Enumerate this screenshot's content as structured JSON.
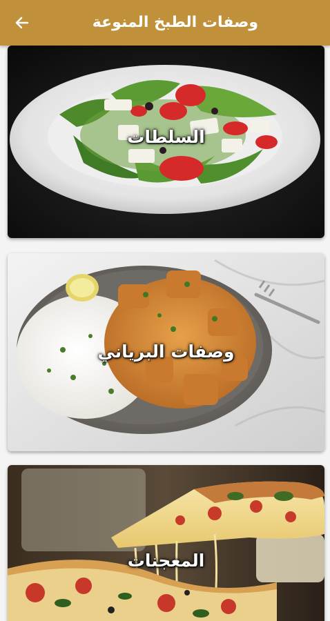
{
  "app": {
    "title": "وصفات الطبخ المنوعة",
    "back_icon": "arrow-left-icon"
  },
  "colors": {
    "appbar": "#c0913a",
    "title_text": "#ffffff"
  },
  "categories": [
    {
      "label": "السلطات",
      "image": "salad-plate"
    },
    {
      "label": "وصفات البرياني",
      "image": "biryani-plate"
    },
    {
      "label": "المعجنات",
      "image": "pizza-slice"
    }
  ]
}
